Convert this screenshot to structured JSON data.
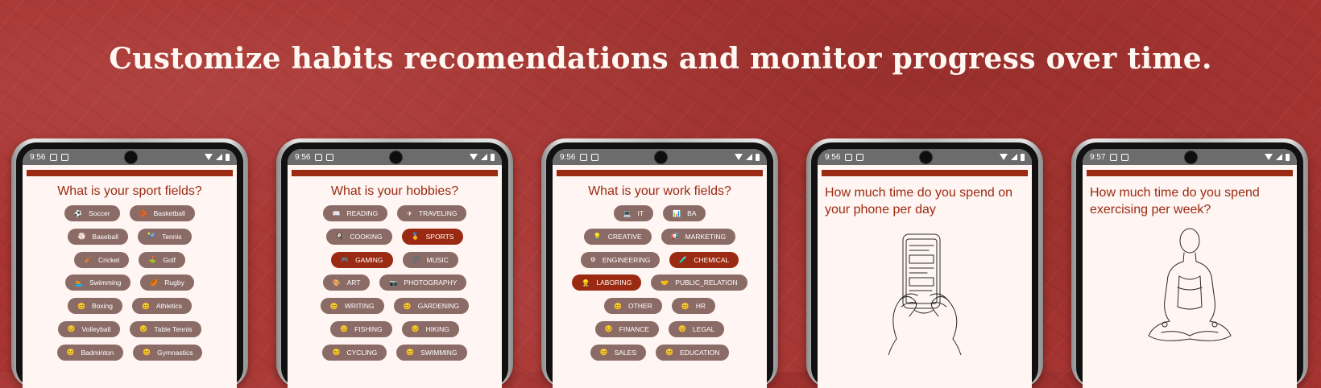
{
  "headline": "Customize habits recomendations and monitor progress over time.",
  "colors": {
    "background": "#a93532",
    "accent": "#9b2a12",
    "chip": "#8b6b66",
    "screen": "#fff5f2"
  },
  "phones": [
    {
      "time": "9:56",
      "title": "What is your sport fields?",
      "rows": [
        [
          {
            "icon": "⚽",
            "label": "Soccer"
          },
          {
            "icon": "🏀",
            "label": "Basketball"
          }
        ],
        [
          {
            "icon": "⚾",
            "label": "Baseball"
          },
          {
            "icon": "🎾",
            "label": "Tennis"
          }
        ],
        [
          {
            "icon": "🏏",
            "label": "Cricket"
          },
          {
            "icon": "⛳",
            "label": "Golf"
          }
        ],
        [
          {
            "icon": "🏊",
            "label": "Swimming"
          },
          {
            "icon": "🏉",
            "label": "Rugby"
          }
        ],
        [
          {
            "icon": "😊",
            "label": "Boxing"
          },
          {
            "icon": "😊",
            "label": "Athletics"
          }
        ],
        [
          {
            "icon": "😊",
            "label": "Volleyball"
          },
          {
            "icon": "😊",
            "label": "Table Tennis"
          }
        ],
        [
          {
            "icon": "😊",
            "label": "Badminton"
          },
          {
            "icon": "😊",
            "label": "Gymnastics"
          }
        ]
      ]
    },
    {
      "time": "9:56",
      "title": "What is your hobbies?",
      "rows": [
        [
          {
            "icon": "📖",
            "label": "READING"
          },
          {
            "icon": "✈",
            "label": "TRAVELING"
          }
        ],
        [
          {
            "icon": "🍳",
            "label": "COOKING"
          },
          {
            "icon": "🏅",
            "label": "SPORTS",
            "selected": true
          }
        ],
        [
          {
            "icon": "🎮",
            "label": "GAMING",
            "selected": true
          },
          {
            "icon": "🎵",
            "label": "MUSIC"
          }
        ],
        [
          {
            "icon": "🎨",
            "label": "ART"
          },
          {
            "icon": "📷",
            "label": "PHOTOGRAPHY"
          }
        ],
        [
          {
            "icon": "😊",
            "label": "WRITING"
          },
          {
            "icon": "😊",
            "label": "GARDENING"
          }
        ],
        [
          {
            "icon": "😊",
            "label": "FISHING"
          },
          {
            "icon": "😊",
            "label": "HIKING"
          }
        ],
        [
          {
            "icon": "😊",
            "label": "CYCLING"
          },
          {
            "icon": "😊",
            "label": "SWIMMING"
          }
        ]
      ]
    },
    {
      "time": "9:56",
      "title": "What is your work fields?",
      "rows": [
        [
          {
            "icon": "💻",
            "label": "IT"
          },
          {
            "icon": "📊",
            "label": "BA"
          }
        ],
        [
          {
            "icon": "💡",
            "label": "CREATIVE"
          },
          {
            "icon": "📢",
            "label": "MARKETING"
          }
        ],
        [
          {
            "icon": "⚙",
            "label": "ENGINEERING"
          },
          {
            "icon": "🧪",
            "label": "CHEMICAL",
            "selected": true
          }
        ],
        [
          {
            "icon": "👷",
            "label": "LABORING",
            "selected": true
          },
          {
            "icon": "🤝",
            "label": "PUBLIC_RELATION"
          }
        ],
        [
          {
            "icon": "😊",
            "label": "OTHER"
          },
          {
            "icon": "😊",
            "label": "HR"
          }
        ],
        [
          {
            "icon": "😊",
            "label": "FINANCE"
          },
          {
            "icon": "😊",
            "label": "LEGAL"
          }
        ],
        [
          {
            "icon": "😊",
            "label": "SALES"
          },
          {
            "icon": "😊",
            "label": "EDUCATION"
          }
        ]
      ]
    },
    {
      "time": "9:56",
      "title": "How much time do you spend on your phone per day",
      "illustration": "hands-holding-phone"
    },
    {
      "time": "9:57",
      "title": "How much time do you spend exercising per week?",
      "illustration": "meditating-person"
    }
  ]
}
